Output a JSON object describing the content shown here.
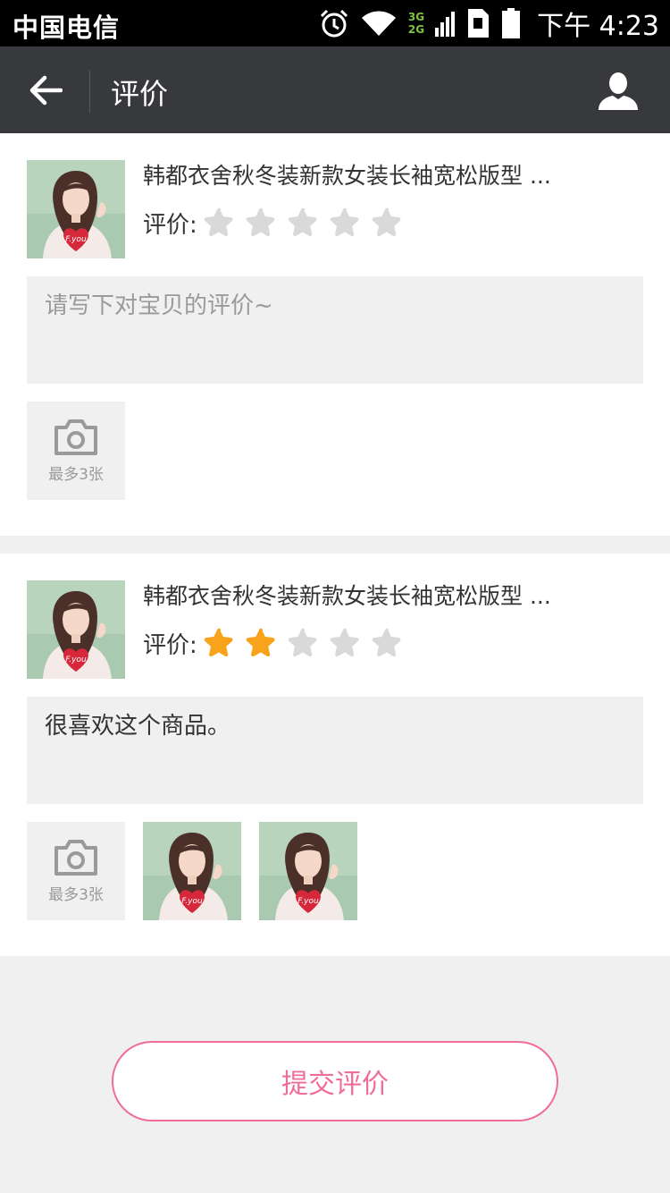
{
  "status_bar": {
    "carrier": "中国电信",
    "network_top": "3G",
    "network_bottom": "2G",
    "time": "下午 4:23",
    "icons": [
      "alarm-icon",
      "wifi-icon",
      "signal-icon",
      "sim-icon",
      "battery-icon"
    ]
  },
  "nav": {
    "title": "评价",
    "back_icon": "arrow-left-icon",
    "user_icon": "user-icon"
  },
  "colors": {
    "nav_bg": "#38393d",
    "accent_pink": "#ef6d96",
    "star_active": "#f9a21b",
    "star_inactive": "#d9d9d9",
    "page_bg": "#f0f0f0"
  },
  "reviews": [
    {
      "product_title": "韩都衣舍秋冬装新款女装长袖宽松版型 ...",
      "rating_label": "评价:",
      "rating": 0,
      "max_rating": 5,
      "comment": "",
      "comment_placeholder": "请写下对宝贝的评价~",
      "add_photo_label": "最多3张",
      "photos_count": 0
    },
    {
      "product_title": "韩都衣舍秋冬装新款女装长袖宽松版型 ...",
      "rating_label": "评价:",
      "rating": 2,
      "max_rating": 5,
      "comment": "很喜欢这个商品。",
      "comment_placeholder": "请写下对宝贝的评价~",
      "add_photo_label": "最多3张",
      "photos_count": 2
    }
  ],
  "submit_label": "提交评价"
}
